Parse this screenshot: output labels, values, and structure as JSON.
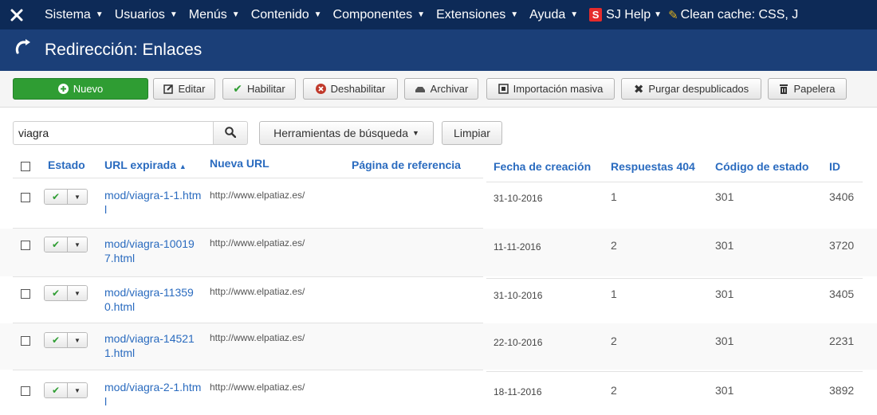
{
  "navbar": {
    "menus": [
      {
        "label": "Sistema"
      },
      {
        "label": "Usuarios"
      },
      {
        "label": "Menús"
      },
      {
        "label": "Contenido"
      },
      {
        "label": "Componentes"
      },
      {
        "label": "Extensiones"
      },
      {
        "label": "Ayuda"
      }
    ],
    "sj_help": {
      "badge": "S",
      "label": "SJ Help"
    },
    "clean_cache": "Clean cache: CSS, J"
  },
  "page": {
    "title": "Redirección: Enlaces"
  },
  "toolbar": {
    "new": "Nuevo",
    "edit": "Editar",
    "enable": "Habilitar",
    "disable": "Deshabilitar",
    "archive": "Archivar",
    "bulk_import": "Importación masiva",
    "purge": "Purgar despublicados",
    "trash": "Papelera"
  },
  "search": {
    "value": "viagra",
    "tools_label": "Herramientas de búsqueda",
    "clear_label": "Limpiar"
  },
  "table": {
    "headers": {
      "state": "Estado",
      "expired_url": "URL expirada",
      "new_url": "Nueva URL",
      "referer": "Página de referencia",
      "created": "Fecha de creación",
      "hits": "Respuestas 404",
      "status_code": "Código de estado",
      "id": "ID"
    },
    "sort_indicator": "▲",
    "rows": [
      {
        "old_url": "mod/viagra-1-1.html",
        "new_url": "http://www.elpatiaz.es/",
        "referer": "",
        "date": "31-10-2016",
        "hits": "1",
        "code": "301",
        "id": "3406"
      },
      {
        "old_url": "mod/viagra-100197.html",
        "new_url": "http://www.elpatiaz.es/",
        "referer": "",
        "date": "11-11-2016",
        "hits": "2",
        "code": "301",
        "id": "3720"
      },
      {
        "old_url": "mod/viagra-113590.html",
        "new_url": "http://www.elpatiaz.es/",
        "referer": "",
        "date": "31-10-2016",
        "hits": "1",
        "code": "301",
        "id": "3405"
      },
      {
        "old_url": "mod/viagra-145211.html",
        "new_url": "http://www.elpatiaz.es/",
        "referer": "",
        "date": "22-10-2016",
        "hits": "2",
        "code": "301",
        "id": "2231"
      },
      {
        "old_url": "mod/viagra-2-1.html",
        "new_url": "http://www.elpatiaz.es/",
        "referer": "",
        "date": "18-11-2016",
        "hits": "2",
        "code": "301",
        "id": "3892"
      }
    ]
  },
  "colors": {
    "navbar_bg": "#0d2a57",
    "subhead_bg": "#1b3f78",
    "primary_green": "#2f9d33",
    "link_blue": "#2a6bbf"
  },
  "icons": {
    "logo": "joomla-logo-icon",
    "refresh": "refresh-icon",
    "new": "plus-circle-icon",
    "edit": "edit-icon",
    "enable": "check-icon",
    "disable": "x-circle-icon",
    "archive": "archive-icon",
    "bulk_import": "import-icon",
    "purge": "x-icon",
    "trash": "trash-icon",
    "search": "search-icon"
  }
}
